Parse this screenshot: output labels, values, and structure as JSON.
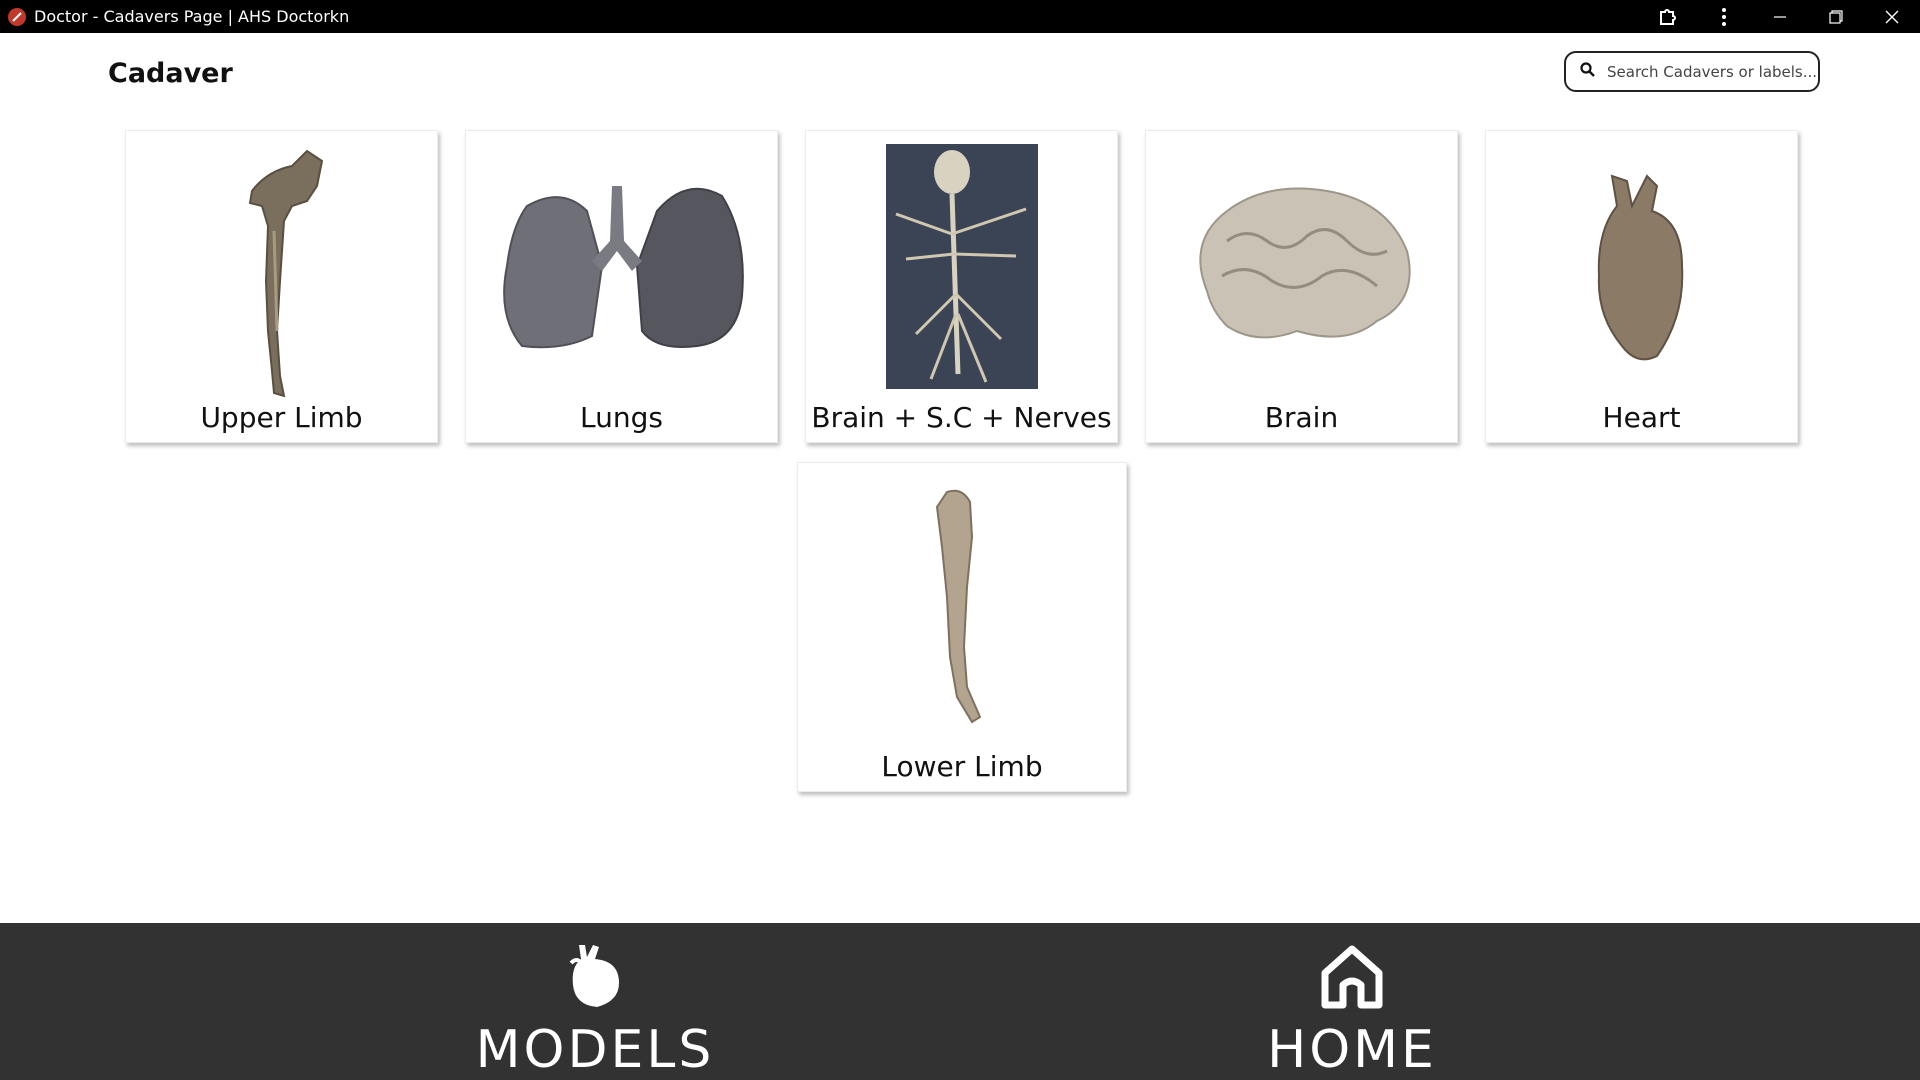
{
  "window": {
    "title": "Doctor - Cadavers Page | AHS Doctorkn"
  },
  "header": {
    "title": "Cadaver",
    "search_placeholder": "Search Cadavers or labels..."
  },
  "cards": [
    {
      "label": "Upper Limb"
    },
    {
      "label": "Lungs"
    },
    {
      "label": "Brain + S.C + Nerves"
    },
    {
      "label": "Brain"
    },
    {
      "label": "Heart"
    },
    {
      "label": "Lower Limb"
    }
  ],
  "bottom_nav": {
    "models_label": "MODELS",
    "home_label": "HOME"
  },
  "colors": {
    "titlebar": "#000000",
    "bottombar": "#323232"
  }
}
